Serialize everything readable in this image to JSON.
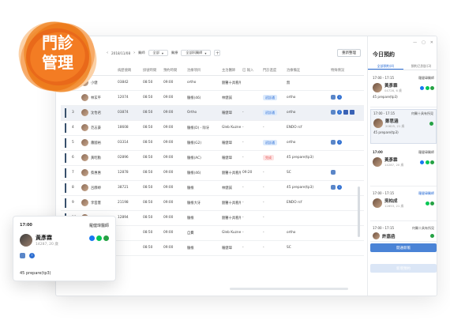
{
  "logo": {
    "line1": "門診",
    "line2": "管理"
  },
  "toolbar": {
    "date": "2018/11/08",
    "filter1_label": "醫師",
    "filter1_value": "全部",
    "filter2_label": "醫療",
    "filter2_value": "全部科醫師",
    "add_button": "重新整理"
  },
  "table": {
    "rows": [
      {
        "no": "",
        "name": "小健",
        "id": "03842",
        "t1": "08:50",
        "t2": "09:00",
        "item": "ortho",
        "doc": "劉醫十具看所見",
        "d2": "",
        "t3": "",
        "status": "",
        "tag": "",
        "note": "無",
        "icons": ""
      },
      {
        "no": "",
        "name": "林玄平",
        "id": "12074",
        "t1": "08:50",
        "t2": "09:00",
        "item": "髓根(46)",
        "doc": "林健誠",
        "d2": "",
        "t3": "09:20",
        "status": "",
        "tag": "初診通",
        "note": "ortho",
        "icons": "a"
      },
      {
        "no": "3",
        "name": "沈怡君",
        "id": "03874",
        "t1": "08:50",
        "t2": "09:00",
        "item": "Ortho",
        "doc": "羅健瑋",
        "d2": "-",
        "t3": "-",
        "status": "",
        "tag": "初診通",
        "note": "ortho",
        "icons": "b"
      },
      {
        "no": "4",
        "name": "范志豪",
        "id": "18608",
        "t1": "08:50",
        "t2": "09:00",
        "item": "髓根(D) - 除牙",
        "doc": "Gleb Kuznetsov",
        "d2": "-",
        "t3": "-",
        "status": "",
        "tag": "",
        "note": "ENDO rcf",
        "icons": ""
      },
      {
        "no": "5",
        "name": "蕭國裕",
        "id": "03314",
        "t1": "08:50",
        "t2": "09:00",
        "item": "髓根(G2)",
        "doc": "羅健瑋",
        "d2": "-",
        "t3": "-",
        "status": "",
        "tag": "初診通",
        "note": "ortho",
        "icons": "a"
      },
      {
        "no": "6",
        "name": "黃昭勳",
        "id": "02896",
        "t1": "08:50",
        "t2": "09:00",
        "item": "髓根(AC)",
        "doc": "羅健瑋",
        "d2": "-",
        "t3": "",
        "status": "完成",
        "tag": "",
        "note": "45 prepare(tp3)",
        "icons": ""
      },
      {
        "no": "7",
        "name": "蔡惠惠",
        "id": "12878",
        "t1": "08:50",
        "t2": "09:00",
        "item": "髓根(46)",
        "doc": "劉醫十具看所見",
        "d2": "09:20",
        "t3": "-",
        "status": "",
        "tag": "",
        "note": "SC",
        "icons": "c"
      },
      {
        "no": "8",
        "name": "呂靜婷",
        "id": "38721",
        "t1": "08:50",
        "t2": "09:00",
        "item": "髓根",
        "doc": "林健誠",
        "d2": "-",
        "t3": "-",
        "status": "",
        "tag": "",
        "note": "45 prepare(tp3)",
        "icons": "a"
      },
      {
        "no": "9",
        "name": "李雲憲",
        "id": "21198",
        "t1": "08:50",
        "t2": "09:00",
        "item": "髓根大牙",
        "doc": "劉醫十具看所見",
        "d2": "-",
        "t3": "-",
        "status": "",
        "tag": "",
        "note": "ENDO rcf",
        "icons": ""
      },
      {
        "no": "10",
        "name": "林展翔",
        "id": "12894",
        "t1": "08:50",
        "t2": "09:00",
        "item": "髓根",
        "doc": "劉醫十具看所見",
        "d2": "-",
        "t3": "-",
        "status": "",
        "tag": "",
        "note": "",
        "icons": ""
      },
      {
        "no": "",
        "name": "",
        "id": "",
        "t1": "08:50",
        "t2": "09:00",
        "item": "自費",
        "doc": "Gleb Kuznetsov",
        "d2": "-",
        "t3": "-",
        "status": "",
        "tag": "",
        "note": "ortho",
        "icons": ""
      },
      {
        "no": "",
        "name": "",
        "id": "",
        "t1": "08:50",
        "t2": "09:00",
        "item": "髓根",
        "doc": "羅健瑋",
        "d2": "-",
        "t3": "-",
        "status": "",
        "tag": "",
        "note": "SC",
        "icons": ""
      }
    ],
    "headers": [
      "",
      "",
      "病歷號碼",
      "掛號時間",
      "預約時間",
      "治療項目",
      "主治醫師",
      "",
      "已 報入",
      "門診進度",
      "治療備註",
      "特殊情況"
    ]
  },
  "panel": {
    "title": "今日預約",
    "tabs": [
      "全部預約(4)",
      "預約已到診(3)"
    ],
    "cards": [
      {
        "time": "17:00 - 17:15",
        "doctor": "羅健瑋醫師",
        "name": "黃彥霖",
        "sub": "04726, 6 歲",
        "note": "45 prepare(tp3)"
      },
      {
        "time": "17:00 - 17:15",
        "doctor": "何醫十具有所見",
        "name": "鄭思涵",
        "sub": "20825, 21 歲",
        "note": "45 prepare(tp3)"
      },
      {
        "time": "17:00",
        "doctor": "羅健瑋醫師",
        "name": "黃彥霖",
        "sub": "14287, 20 歲",
        "note": ""
      },
      {
        "time": "17:00 - 17:15",
        "doctor": "羅健瑋醫師",
        "name": "吳柏成",
        "sub": "12653, 21 歲",
        "note": ""
      },
      {
        "time": "17:00 - 17:15",
        "doctor": "何醫十具有所見",
        "name": "許嘉函",
        "sub": "",
        "note": ""
      }
    ],
    "primary_button": "開通新帳",
    "secondary_button": "新增預約"
  },
  "popup": {
    "time": "17:00",
    "doctor": "羅健瑋醫師",
    "name": "黃彥霖",
    "sub": "14287, 20 歲",
    "note": "45 prepare(tp3)"
  }
}
